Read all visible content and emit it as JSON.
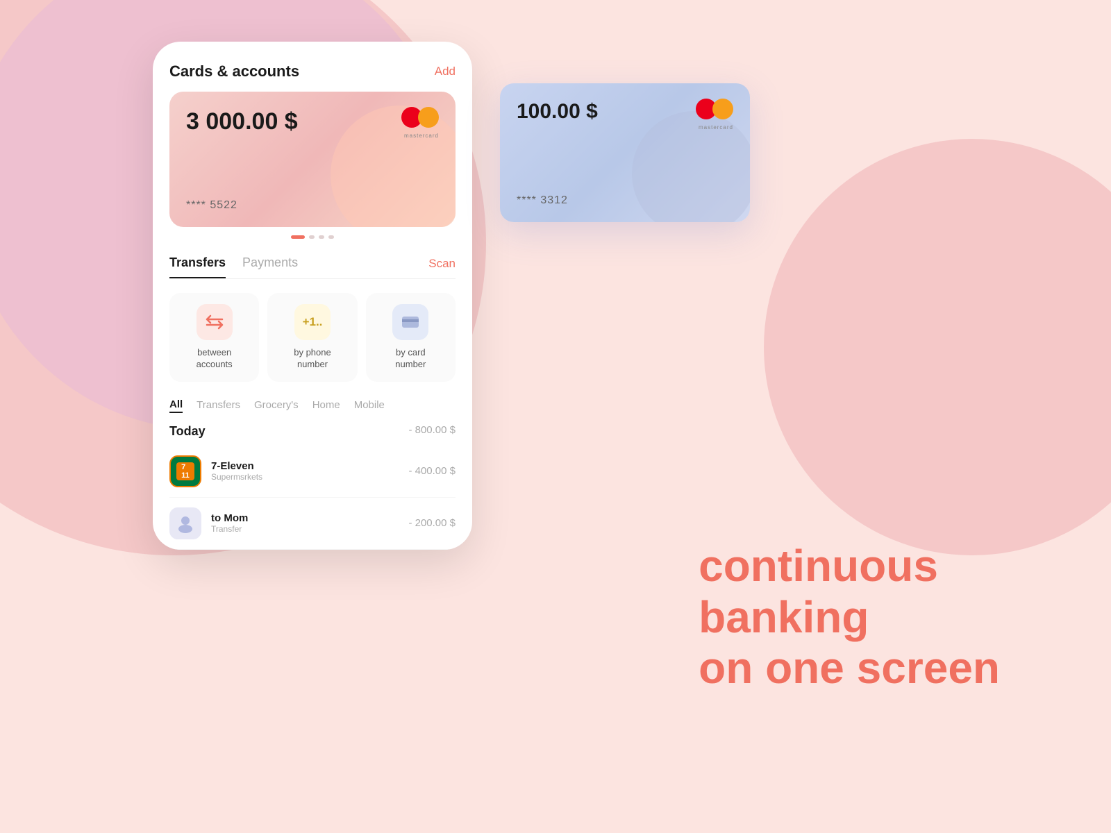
{
  "background": {
    "color": "#fce4e0"
  },
  "cards_section": {
    "title": "Cards & accounts",
    "add_button": "Add"
  },
  "primary_card": {
    "amount": "3 000.00 $",
    "card_number": "**** 5522",
    "brand": "mastercard"
  },
  "secondary_card": {
    "amount": "100.00 $",
    "card_number": "**** 3312",
    "brand": "mastercard"
  },
  "tabs": {
    "transfers_label": "Transfers",
    "payments_label": "Payments",
    "scan_label": "Scan"
  },
  "transfer_options": [
    {
      "icon": "⇄",
      "label": "between\naccounts",
      "icon_style": "pink"
    },
    {
      "icon": "+1..",
      "label": "by phone\nnumber",
      "icon_style": "yellow"
    },
    {
      "icon": "▣",
      "label": "by card\nnumber",
      "icon_style": "blue"
    }
  ],
  "filter_tabs": [
    "All",
    "Transfers",
    "Grocery's",
    "Home",
    "Mobile"
  ],
  "today_section": {
    "label": "Today",
    "total": "- 800.00 $"
  },
  "transactions": [
    {
      "name": "7-Eleven",
      "sub": "Supermsrkets",
      "amount": "- 400.00 $",
      "logo_type": "711"
    },
    {
      "name": "to Mom",
      "sub": "Transfer",
      "amount": "- 200.00 $",
      "logo_type": "mom"
    }
  ],
  "tagline": {
    "line1": "continuous",
    "line2": "banking",
    "line3": "on one screen"
  },
  "dots": [
    {
      "active": true
    },
    {
      "active": false
    },
    {
      "active": false
    },
    {
      "active": false
    }
  ]
}
